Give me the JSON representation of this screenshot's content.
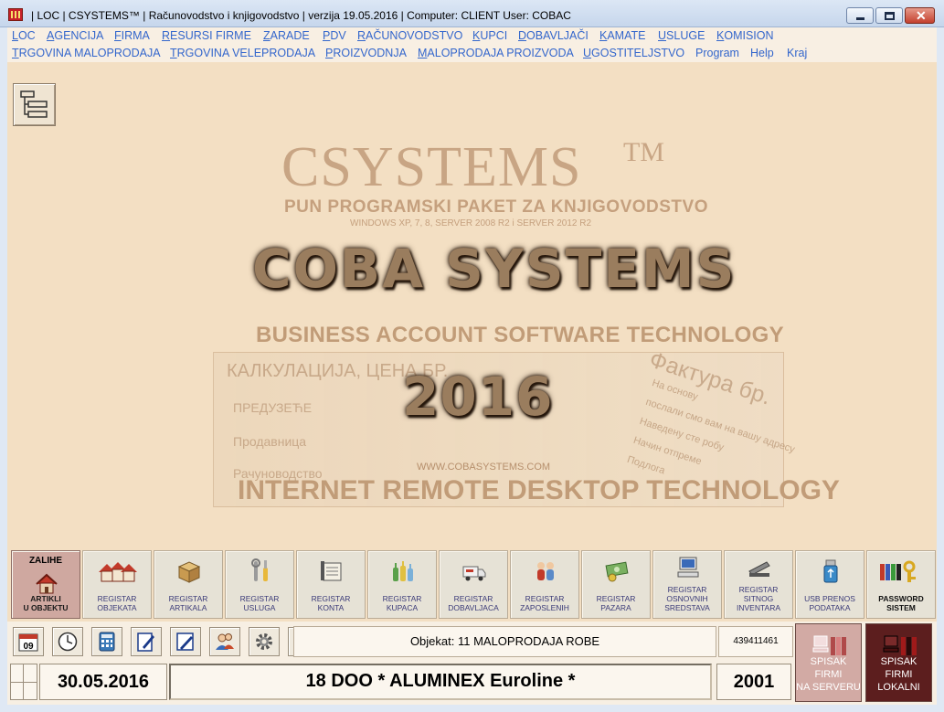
{
  "window": {
    "title": "| LOC | CSYSTEMS™ | Računovodstvo i knjigovodstvo |   verzija 19.05.2016  |  Computer: CLIENT  User: COBAC",
    "minimize_icon": "minimize-icon",
    "maximize_icon": "maximize-icon",
    "close_icon": "close-icon"
  },
  "menu_row1": [
    "LOC",
    "AGENCIJA",
    "FIRMA",
    "RESURSI FIRME",
    "ZARADE",
    "PDV",
    "RAČUNOVODSTVO",
    "KUPCI",
    "DOBAVLJAČI",
    "KAMATE",
    "USLUGE",
    "KOMISION"
  ],
  "menu_row2": [
    "TRGOVINA MALOPRODAJA",
    "TRGOVINA VELEPRODAJA",
    "PROIZVODNJA",
    "MALOPRODAJA PROIZVODA",
    "UGOSTITELJSTVO",
    "Program",
    "Help",
    "Kraj"
  ],
  "splash": {
    "brand": "CSYSTEMS",
    "tm": "TM",
    "tagline": "PUN PROGRAMSKI PAKET ZA KNJIGOVODSTVO",
    "platforms": "WINDOWS XP, 7, 8, SERVER 2008 R2 i SERVER 2012 R2",
    "company": "COBA SYSTEMS",
    "subtitle": "BUSINESS ACCOUNT SOFTWARE TECHNOLOGY",
    "year": "2016",
    "website": "WWW.COBASYSTEMS.COM",
    "footer": "INTERNET REMOTE DESKTOP TECHNOLOGY",
    "ghost_doc_title": "КАЛКУЛАЦИЈА, ЦЕНА БР.",
    "ghost_doc_rows": [
      "ПРЕДУЗЕЋЕ",
      "Продавница",
      "Рачуноводство"
    ],
    "ghost_invoice_title": "Фактура бр.",
    "ghost_invoice_rows": [
      "На основу",
      "послали смо вам на вашу адресу",
      "Наведену сте робу",
      "Начин отпреме",
      "Подлога"
    ]
  },
  "toolbar": [
    {
      "top": "ZALIHE",
      "lines": [
        "ARTIKLI",
        "U OBJEKTU"
      ],
      "icon": "house-icon",
      "active": true
    },
    {
      "lines": [
        "REGISTAR",
        "OBJEKATA"
      ],
      "icon": "houses-icon"
    },
    {
      "lines": [
        "REGISTAR",
        "ARTIKALA"
      ],
      "icon": "box-icon"
    },
    {
      "lines": [
        "REGISTAR",
        "USLUGA"
      ],
      "icon": "tools-icon"
    },
    {
      "lines": [
        "REGISTAR",
        "KONTA"
      ],
      "icon": "ledger-icon"
    },
    {
      "lines": [
        "REGISTAR",
        "KUPACA"
      ],
      "icon": "bottles-icon"
    },
    {
      "lines": [
        "REGISTAR",
        "DOBAVLJACA"
      ],
      "icon": "truck-icon"
    },
    {
      "lines": [
        "REGISTAR",
        "ZAPOSLENIH"
      ],
      "icon": "people-icon"
    },
    {
      "lines": [
        "REGISTAR",
        "PAZARA"
      ],
      "icon": "money-icon"
    },
    {
      "lines": [
        "REGISTAR",
        "OSNOVNIH",
        "SREDSTAVA"
      ],
      "icon": "computer-icon"
    },
    {
      "lines": [
        "REGISTAR",
        "SITNOG",
        "INVENTARA"
      ],
      "icon": "stapler-icon"
    },
    {
      "lines": [
        "USB PRENOS",
        "PODATAKA"
      ],
      "icon": "usb-icon"
    },
    {
      "lines": [
        "PASSWORD",
        "SISTEM"
      ],
      "icon": "keys-icon",
      "bold": true
    }
  ],
  "small_buttons": [
    "calendar-icon",
    "clock-icon",
    "calculator-icon",
    "notepad-icon",
    "pen-icon",
    "users-icon",
    "gear-icon",
    "network-icon"
  ],
  "calendar_day": "09",
  "objekat": "Objekat: 11  MALOPRODAJA ROBE",
  "code": "439411461",
  "date": "30.05.2016",
  "firm": "18  DOO * ALUMINEX Euroline *",
  "year": "2001",
  "server_button": [
    "SPISAK FIRMI",
    "NA SERVERU"
  ],
  "local_button": [
    "SPISAK FIRMI",
    "LOKALNI"
  ],
  "colors": {
    "menu_link": "#3366cc",
    "splash_bg": "#f3dfc3",
    "local_button": "#5c1e1e",
    "server_button": "#d2aaa4"
  }
}
